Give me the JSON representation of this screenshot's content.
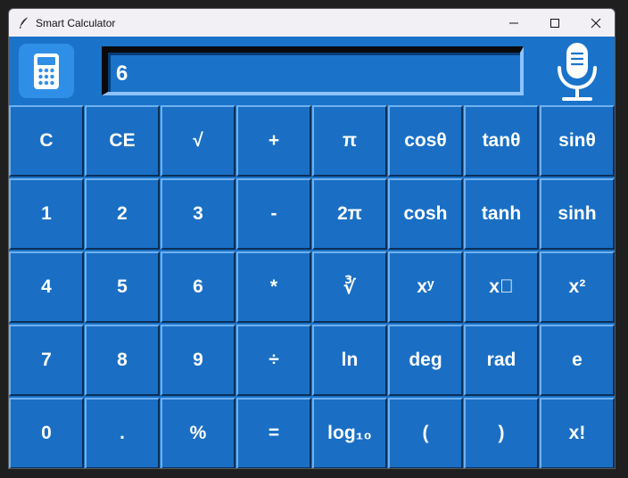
{
  "window": {
    "title": "Smart Calculator"
  },
  "display": {
    "value": "6"
  },
  "keys": [
    [
      "C",
      "CE",
      "√",
      "+",
      "π",
      "cosθ",
      "tanθ",
      "sinθ"
    ],
    [
      "1",
      "2",
      "3",
      "-",
      "2π",
      "cosh",
      "tanh",
      "sinh"
    ],
    [
      "4",
      "5",
      "6",
      "*",
      "∛",
      "xʸ",
      "x⃞",
      "x²"
    ],
    [
      "7",
      "8",
      "9",
      "÷",
      "ln",
      "deg",
      "rad",
      "e"
    ],
    [
      "0",
      ".",
      "%",
      "=",
      "log₁₀",
      "(",
      ")",
      "x!"
    ]
  ],
  "icons": {
    "app": "feather-icon",
    "calculator": "calculator-icon",
    "voice": "microphone-icon"
  },
  "colors": {
    "accent": "#1a73c9",
    "key": "#1a6fc4",
    "text": "#ffffff"
  }
}
